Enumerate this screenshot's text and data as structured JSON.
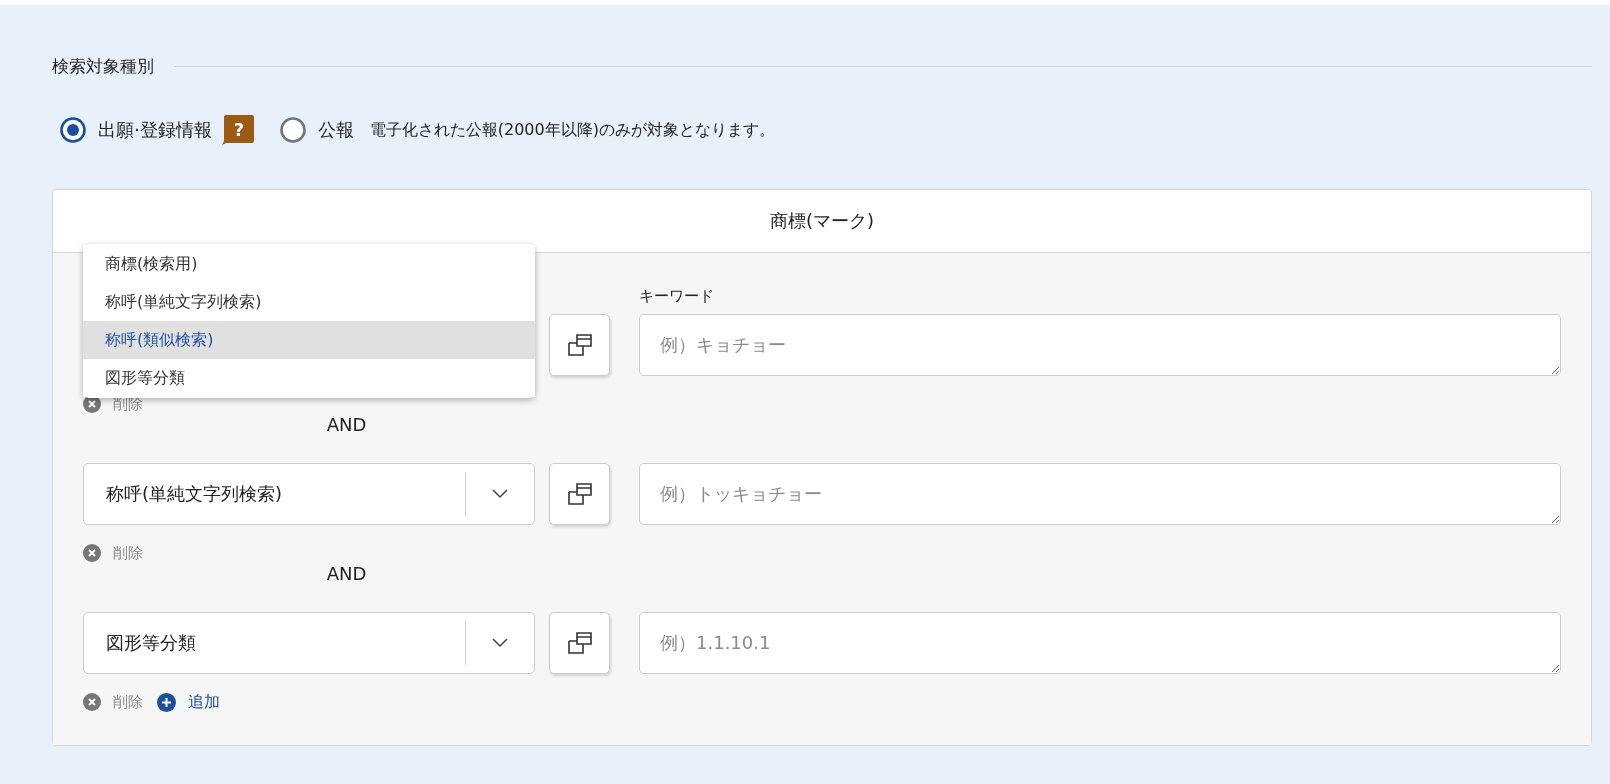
{
  "section_title": "検索対象種別",
  "radios": [
    {
      "label": "出願·登録情報",
      "selected": true,
      "help_icon": "?"
    },
    {
      "label": "公報",
      "selected": false
    }
  ],
  "note": "電子化された公報(2000年以降)のみが対象となります。",
  "panel": {
    "title": "商標(マーク)",
    "rows": [
      {
        "keyword_label": "キーワード",
        "placeholder": "例）キョチョー",
        "delete": "削除"
      },
      {
        "select_value": "称呼(単純文字列検索)",
        "placeholder": "例）トッキョチョー",
        "delete": "削除"
      },
      {
        "select_value": "図形等分類",
        "placeholder": "例）1.1.10.1",
        "delete": "削除",
        "add": "追加"
      }
    ],
    "connectors": [
      "AND",
      "AND"
    ]
  },
  "dropdown": {
    "options": [
      {
        "label": "商標(検索用)",
        "selected": false
      },
      {
        "label": "称呼(単純文字列検索)",
        "selected": false
      },
      {
        "label": "称呼(類似検索)",
        "selected": true
      },
      {
        "label": "図形等分類",
        "selected": false
      }
    ]
  }
}
